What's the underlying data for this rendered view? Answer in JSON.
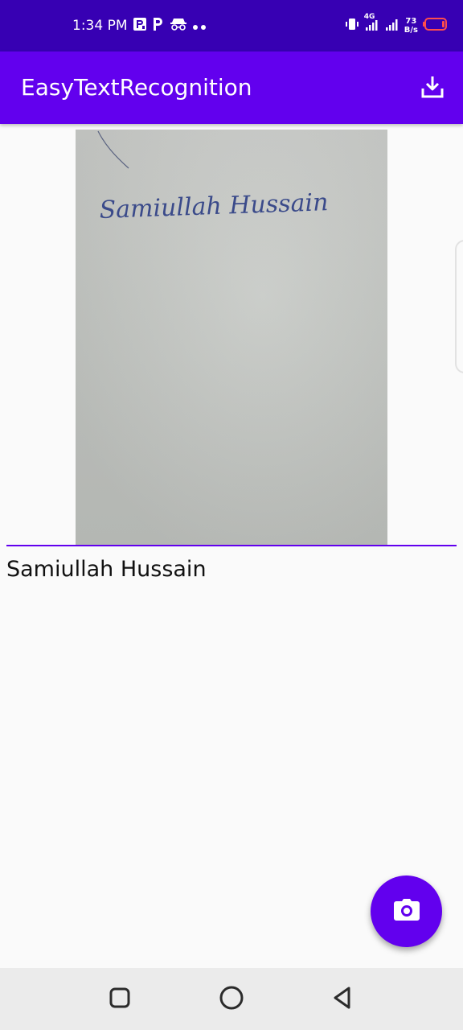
{
  "status_bar": {
    "time": "1:34 PM",
    "network_type": "4G",
    "net_speed_value": "73",
    "net_speed_unit": "B/s",
    "icons": [
      "parking-app-icon",
      "parking-icon",
      "incognito-icon",
      "more-dots-icon",
      "vibrate-icon",
      "signal-icon",
      "signal-icon-2",
      "battery-icon"
    ]
  },
  "app_bar": {
    "title": "EasyTextRecognition",
    "action_icon": "download-icon"
  },
  "photo": {
    "handwritten_text": "Samiullah Hussain"
  },
  "result": {
    "recognized_text": "Samiullah Hussain"
  },
  "fab": {
    "icon": "camera-icon"
  },
  "nav_bar": {
    "buttons": [
      "recents-icon",
      "home-icon",
      "back-icon"
    ]
  },
  "colors": {
    "status_bar": "#3700b3",
    "primary": "#6200ee",
    "background": "#fafafa",
    "battery_low": "#ff4d4d"
  }
}
